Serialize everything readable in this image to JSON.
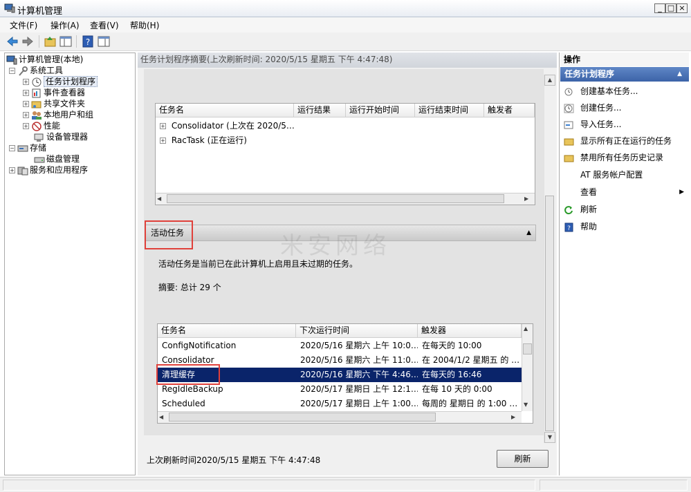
{
  "window": {
    "title": "计算机管理",
    "minimize": "_",
    "restore": "□",
    "close": "×"
  },
  "menu": [
    "文件(F)",
    "操作(A)",
    "查看(V)",
    "帮助(H)"
  ],
  "tree": {
    "root": "计算机管理(本地)",
    "system_tools": "系统工具",
    "task_scheduler": "任务计划程序",
    "event_viewer": "事件查看器",
    "shared_folders": "共享文件夹",
    "local_users": "本地用户和组",
    "performance": "性能",
    "device_manager": "设备管理器",
    "storage": "存储",
    "disk_mgmt": "磁盘管理",
    "services_apps": "服务和应用程序"
  },
  "center": {
    "header": "任务计划程序摘要(上次刷新时间: 2020/5/15 星期五 下午 4:47:48)",
    "status_table": {
      "columns": [
        "任务名",
        "运行结果",
        "运行开始时间",
        "运行结束时间",
        "触发者"
      ],
      "rows": [
        "Consolidator (上次在 2020/5…",
        "RacTask (正在运行)"
      ]
    },
    "active_section_title": "活动任务",
    "active_desc": "活动任务是当前已在此计算机上启用且未过期的任务。",
    "summary": "摘要: 总计 29 个",
    "active_table": {
      "columns": [
        "任务名",
        "下次运行时间",
        "触发器"
      ],
      "rows": [
        [
          "ConfigNotification",
          "2020/5/16 星期六 上午 10:0…",
          "在每天的 10:00"
        ],
        [
          "Consolidator",
          "2020/5/16 星期六 上午 11:0…",
          "在 2004/1/2 星期五 的 …"
        ],
        [
          "清理缓存",
          "2020/5/16 星期六 下午 4:46…",
          "在每天的 16:46"
        ],
        [
          "RegIdleBackup",
          "2020/5/17 星期日 上午 12:1…",
          "在每 10 天的 0:00"
        ],
        [
          "Scheduled",
          "2020/5/17 星期日 上午 1:00…",
          "每周的 星期日 的 1:00 …"
        ]
      ],
      "selected_index": 2
    },
    "last_refresh": "上次刷新时间2020/5/15 星期五 下午 4:47:48",
    "refresh_button": "刷新"
  },
  "actions": {
    "title": "操作",
    "section": "任务计划程序",
    "items": [
      "创建基本任务...",
      "创建任务...",
      "导入任务...",
      "显示所有正在运行的任务",
      "禁用所有任务历史记录",
      "AT 服务帐户配置",
      "查看",
      "刷新",
      "帮助"
    ]
  },
  "watermark": "米安网络",
  "colors": {
    "selection": "#0a246a",
    "highlight_box": "#e0403a",
    "section_header": "#3c63a8"
  }
}
